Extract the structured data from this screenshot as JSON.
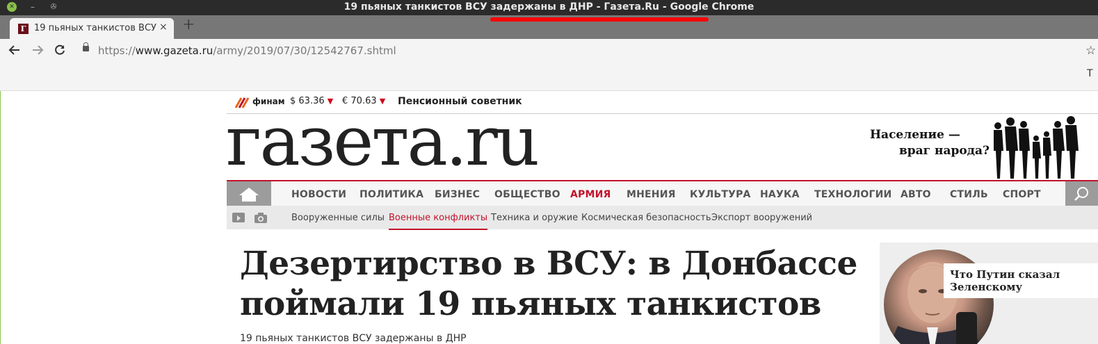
{
  "window": {
    "title": "19 пьяных танкистов ВСУ задержаны в ДНР - Газета.Ru - Google Chrome"
  },
  "tab": {
    "favicon_letter": "Г",
    "title": "19 пьяных танкистов ВСУ задержаны в ДНР - Газета.Ru",
    "close": "×",
    "new_tab": "+"
  },
  "toolbar": {
    "url_scheme": "https://",
    "url_host": "www.gazeta.ru",
    "url_path": "/army/2019/07/30/12542767.shtml",
    "star": "☆",
    "bookmark_edge": "T"
  },
  "ticker": {
    "finam_label": "финам",
    "usd": "$ 63.36",
    "eur": "€ 70.63",
    "down": "▼",
    "pension": "Пенсионный советник"
  },
  "site": {
    "logo": "газета.ru",
    "promo_line1": "Население —",
    "promo_line2": "враг народа?"
  },
  "nav": {
    "items": [
      "НОВОСТИ",
      "ПОЛИТИКА",
      "БИЗНЕС",
      "ОБЩЕСТВО",
      "АРМИЯ",
      "МНЕНИЯ",
      "КУЛЬТУРА",
      "НАУКА",
      "ТЕХНОЛОГИИ",
      "АВТО",
      "СТИЛЬ",
      "СПОРТ"
    ],
    "active": "АРМИЯ"
  },
  "subnav": {
    "items": [
      "Вооруженные силы",
      "Военные конфликты",
      "Техника и оружие",
      "Космическая безопасность",
      "Экспорт вооружений"
    ],
    "active": "Военные конфликты"
  },
  "article": {
    "headline_line1": "Дезертирство в ВСУ: в Донбассе",
    "headline_line2": "поймали 19 пьяных танкистов",
    "subtitle": "19 пьяных танкистов ВСУ задержаны в ДНР"
  },
  "sidebar": {
    "card_title": "Что Путин сказал Зеленскому"
  },
  "colors": {
    "accent": "#c3122a",
    "titlebar": "#2b2b2b",
    "tabstrip": "#777777"
  }
}
